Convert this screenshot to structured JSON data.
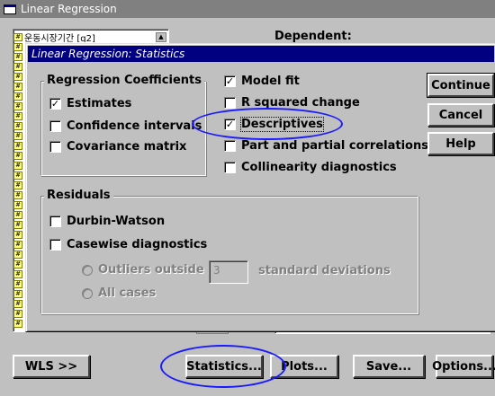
{
  "main_window": {
    "title": "Linear Regression",
    "dependent_label": "Dependent:",
    "first_variable": "운동시장기간 [q2]",
    "buttons": {
      "wls": "WLS >>",
      "statistics": "Statistics...",
      "plots": "Plots...",
      "save": "Save...",
      "options": "Options..."
    }
  },
  "dialog": {
    "title": "Linear Regression: Statistics",
    "regression_coefficients": {
      "label": "Regression Coefficients",
      "items": [
        {
          "label": "Estimates",
          "checked": true
        },
        {
          "label": "Confidence intervals",
          "checked": false
        },
        {
          "label": "Covariance matrix",
          "checked": false
        }
      ]
    },
    "right_checkboxes": [
      {
        "label": "Model fit",
        "checked": true
      },
      {
        "label": "R squared change",
        "checked": false
      },
      {
        "label": "Descriptives",
        "checked": true
      },
      {
        "label": "Part and partial correlations",
        "checked": false
      },
      {
        "label": "Collinearity diagnostics",
        "checked": false
      }
    ],
    "residuals": {
      "label": "Residuals",
      "durbin_watson": {
        "label": "Durbin-Watson",
        "checked": false
      },
      "casewise": {
        "label": "Casewise diagnostics",
        "checked": false
      },
      "outliers_outside": {
        "label": "Outliers outside",
        "value": "3",
        "unit": "standard deviations"
      },
      "all_cases": {
        "label": "All cases"
      }
    },
    "buttons": {
      "continue": "Continue",
      "cancel": "Cancel",
      "help": "Help"
    }
  },
  "colors": {
    "face": "#c0c0c0",
    "title_active": "#000080",
    "title_inactive": "#808080",
    "annotation": "#1a1aff"
  }
}
